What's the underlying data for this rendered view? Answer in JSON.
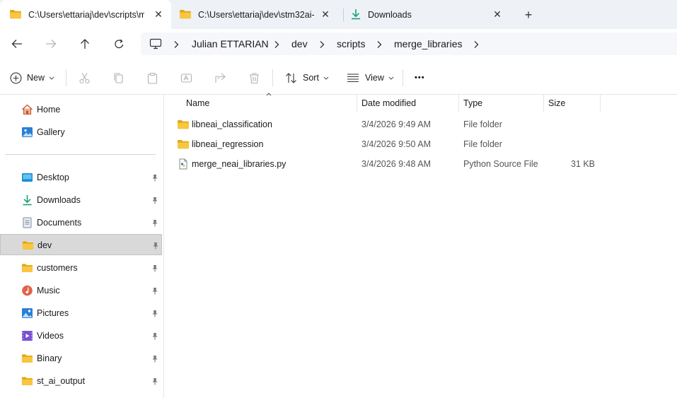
{
  "tabs": [
    {
      "label": "C:\\Users\\ettariaj\\dev\\scripts\\merge_libraries",
      "active": true,
      "icon": "folder-icon"
    },
    {
      "label": "C:\\Users\\ettariaj\\dev\\stm32ai-",
      "active": false,
      "icon": "folder-icon"
    },
    {
      "label": "Downloads",
      "active": false,
      "icon": "download-icon"
    }
  ],
  "tab_close_glyph": "✕",
  "new_tab_glyph": "+",
  "breadcrumb": [
    "Julian ETTARIAN",
    "dev",
    "scripts",
    "merge_libraries"
  ],
  "toolbar": {
    "new_label": "New",
    "sort_label": "Sort",
    "view_label": "View",
    "more_glyph": "•••"
  },
  "sidebar": {
    "top_items": [
      {
        "label": "Home",
        "icon": "home-icon"
      },
      {
        "label": "Gallery",
        "icon": "gallery-icon"
      }
    ],
    "pinned_items": [
      {
        "label": "Desktop",
        "icon": "desktop-icon"
      },
      {
        "label": "Downloads",
        "icon": "download-icon"
      },
      {
        "label": "Documents",
        "icon": "documents-icon"
      },
      {
        "label": "dev",
        "icon": "folder-icon",
        "selected": true
      },
      {
        "label": "customers",
        "icon": "folder-icon"
      },
      {
        "label": "Music",
        "icon": "music-icon"
      },
      {
        "label": "Pictures",
        "icon": "pictures-icon"
      },
      {
        "label": "Videos",
        "icon": "videos-icon"
      },
      {
        "label": "Binary",
        "icon": "folder-icon"
      },
      {
        "label": "st_ai_output",
        "icon": "folder-icon"
      }
    ]
  },
  "columns": {
    "name": "Name",
    "date": "Date modified",
    "type": "Type",
    "size": "Size"
  },
  "files": [
    {
      "name": "libneai_classification",
      "date": "3/4/2026 9:49 AM",
      "type": "File folder",
      "size": "",
      "icon": "folder-icon"
    },
    {
      "name": "libneai_regression",
      "date": "3/4/2026 9:50 AM",
      "type": "File folder",
      "size": "",
      "icon": "folder-icon"
    },
    {
      "name": "merge_neai_libraries.py",
      "date": "3/4/2026 9:48 AM",
      "type": "Python Source File",
      "size": "31 KB",
      "icon": "python-file-icon"
    }
  ],
  "colors": {
    "folder": "#f8c640",
    "folder_dark": "#e2a816",
    "accent": "#0067c0",
    "download": "#1a9e72"
  }
}
